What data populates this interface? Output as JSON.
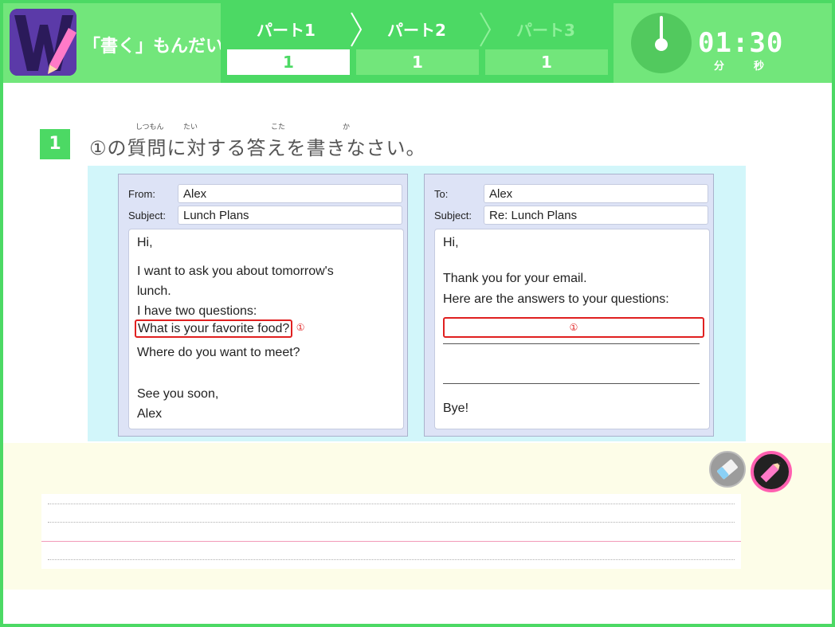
{
  "header": {
    "title": "「書く」もんだい",
    "parts": [
      {
        "label": "パート1",
        "count": "1",
        "state": "active"
      },
      {
        "label": "パート2",
        "count": "1",
        "state": "done"
      },
      {
        "label": "パート3",
        "count": "1",
        "state": "upcoming"
      }
    ],
    "timer": {
      "value": "01:30",
      "unit_min": "分",
      "unit_sec": "秒"
    }
  },
  "question": {
    "number": "1",
    "text": "①の質問に対する答えを書きなさい。",
    "ruby": [
      "しつもん",
      "たい",
      "こた",
      "か"
    ]
  },
  "email_left": {
    "from_label": "From:",
    "from_value": "Alex",
    "subject_label": "Subject:",
    "subject_value": "Lunch Plans",
    "body": {
      "greeting": "Hi,",
      "line1": "I want to ask you about tomorrow's",
      "line2": "lunch.",
      "line3": "I have two questions:",
      "question1": "What is your favorite food?",
      "question1_marker": "①",
      "question2": "Where do you want to meet?",
      "closing": "See you soon,",
      "signature": "Alex"
    }
  },
  "email_right": {
    "to_label": "To:",
    "to_value": "Alex",
    "subject_label": "Subject:",
    "subject_value": "Re: Lunch Plans",
    "body": {
      "greeting": "Hi,",
      "line1": "Thank you for your email.",
      "line2": "Here are the answers to your questions:",
      "answer_marker": "①",
      "closing": "Bye!"
    }
  },
  "tools": [
    {
      "name": "eraser-icon",
      "selected": false
    },
    {
      "name": "pencil-icon",
      "selected": true
    }
  ],
  "colors": {
    "accent": "#4cd964",
    "header_light": "#72e67b",
    "highlight": "#e02020",
    "panel": "#d2f6fa",
    "writing_bg": "#fdfde8",
    "pencil_ring": "#ff5fb0"
  }
}
